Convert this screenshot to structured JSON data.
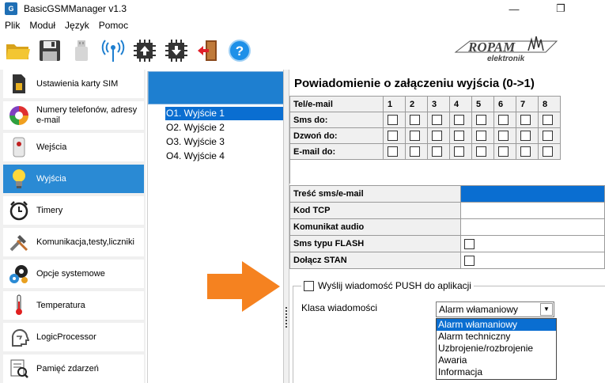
{
  "window": {
    "title": "BasicGSMManager v1.3",
    "minimize": "—",
    "restore": "❐"
  },
  "menu": [
    "Plik",
    "Moduł",
    "Język",
    "Pomoc"
  ],
  "toolbar": {
    "icons": [
      "folder-open-icon",
      "save-icon",
      "usb-icon",
      "antenna-icon",
      "chip-upload-icon",
      "chip-download-icon",
      "exit-door-icon",
      "help-icon"
    ],
    "help_label": "?"
  },
  "logo": {
    "name": "ROPAM",
    "sub": "elektronik"
  },
  "sidebar": {
    "items": [
      {
        "label": "Ustawienia karty SIM",
        "icon": "sim-card-icon"
      },
      {
        "label": "Numery telefonów, adresy e-mail",
        "icon": "pie-chart-icon"
      },
      {
        "label": "Wejścia",
        "icon": "motion-sensor-icon"
      },
      {
        "label": "Wyjścia",
        "icon": "light-bulb-icon"
      },
      {
        "label": "Timery",
        "icon": "alarm-clock-icon"
      },
      {
        "label": "Komunikacja,testy,liczniki",
        "icon": "tools-icon"
      },
      {
        "label": "Opcje systemowe",
        "icon": "gears-icon"
      },
      {
        "label": "Temperatura",
        "icon": "thermometer-icon"
      },
      {
        "label": "LogicProcessor",
        "icon": "head-logic-icon"
      },
      {
        "label": "Pamięć zdarzeń",
        "icon": "event-log-icon"
      }
    ],
    "active_index": 3
  },
  "outputs_list": {
    "items": [
      "O1. Wyjście 1",
      "O2. Wyjście 2",
      "O3. Wyjście 3",
      "O4. Wyjście 4"
    ],
    "selected_index": 0
  },
  "main": {
    "title": "Powiadomienie o załączeniu wyjścia (0->1)",
    "grid": {
      "header_label": "Tel/e-mail",
      "columns": [
        "1",
        "2",
        "3",
        "4",
        "5",
        "6",
        "7",
        "8"
      ],
      "rows": [
        "Sms do:",
        "Dzwoń do:",
        "E-mail do:"
      ]
    },
    "params": [
      {
        "label": "Treść sms/e-mail",
        "type": "text-selected"
      },
      {
        "label": "Kod TCP",
        "type": "text"
      },
      {
        "label": "Komunikat audio",
        "type": "text"
      },
      {
        "label": "Sms typu FLASH",
        "type": "checkbox"
      },
      {
        "label": "Dołącz STAN",
        "type": "checkbox"
      }
    ],
    "push": {
      "checkbox_label": "Wyślij wiadomość PUSH do aplikacji",
      "class_label": "Klasa wiadomości",
      "selected": "Alarm włamaniowy",
      "options": [
        "Alarm włamaniowy",
        "Alarm techniczny",
        "Uzbrojenie/rozbrojenie",
        "Awaria",
        "Informacja"
      ]
    }
  },
  "colors": {
    "accent": "#2a8ad4",
    "selection": "#0a6ed1",
    "arrow": "#f58220"
  }
}
